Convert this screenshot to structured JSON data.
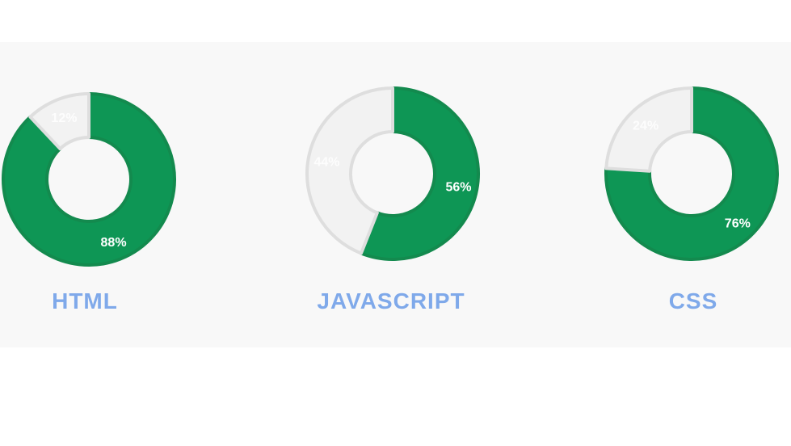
{
  "colors": {
    "filled": "#0e9655",
    "filled_stroke": "#138a4e",
    "empty": "#f2f2f2",
    "empty_stroke": "#dedede",
    "title": "#7fa9ea",
    "panel_bg": "#f8f8f8"
  },
  "chart_data": [
    {
      "type": "pie",
      "variant": "donut",
      "title": "HTML",
      "categories": [
        "filled",
        "remaining"
      ],
      "values": [
        88,
        12
      ],
      "labels": [
        "88%",
        "12%"
      ]
    },
    {
      "type": "pie",
      "variant": "donut",
      "title": "JAVASCRIPT",
      "categories": [
        "filled",
        "remaining"
      ],
      "values": [
        56,
        44
      ],
      "labels": [
        "56%",
        "44%"
      ]
    },
    {
      "type": "pie",
      "variant": "donut",
      "title": "CSS",
      "categories": [
        "filled",
        "remaining"
      ],
      "values": [
        76,
        24
      ],
      "labels": [
        "76%",
        "24%"
      ]
    }
  ]
}
